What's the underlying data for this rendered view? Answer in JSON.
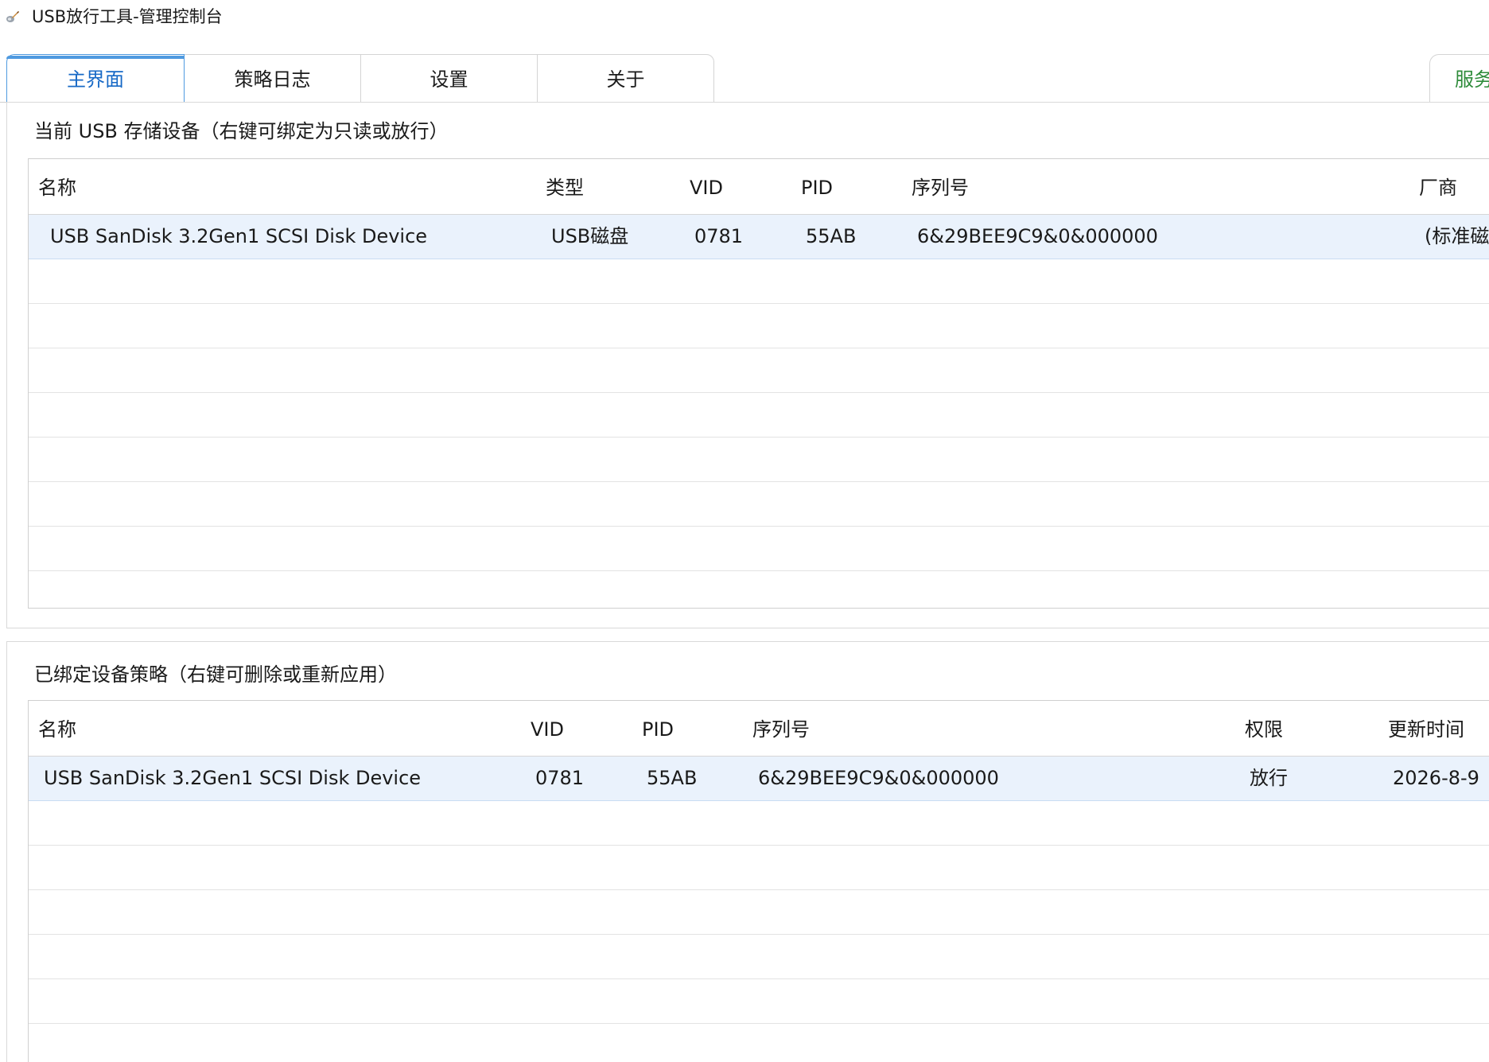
{
  "window": {
    "title": "USB放行工具-管理控制台",
    "icon": "app-brush-icon"
  },
  "tabs": [
    {
      "label": "主界面",
      "active": true
    },
    {
      "label": "策略日志",
      "active": false
    },
    {
      "label": "设置",
      "active": false
    },
    {
      "label": "关于",
      "active": false
    }
  ],
  "service_tab": {
    "label": "服务"
  },
  "devices_panel": {
    "title": "当前 USB 存储设备（右键可绑定为只读或放行）",
    "columns": [
      "名称",
      "类型",
      "VID",
      "PID",
      "序列号",
      "厂商"
    ],
    "rows": [
      {
        "name": "USB  SanDisk 3.2Gen1 SCSI Disk Device",
        "type": "USB磁盘",
        "vid": "0781",
        "pid": "55AB",
        "serial": "6&29BEE9C9&0&000000",
        "vendor": "(标准磁"
      }
    ]
  },
  "policies_panel": {
    "title": "已绑定设备策略（右键可删除或重新应用）",
    "columns": [
      "名称",
      "VID",
      "PID",
      "序列号",
      "权限",
      "更新时间"
    ],
    "rows": [
      {
        "name": "USB  SanDisk 3.2Gen1 SCSI Disk Device",
        "vid": "0781",
        "pid": "55AB",
        "serial": "6&29BEE9C9&0&000000",
        "permission": "放行",
        "updated": "2026-8-9"
      }
    ]
  },
  "colors": {
    "active_tab_text": "#1769c6",
    "active_tab_border": "#4f9ae0",
    "service_tab_text": "#2e8b3a",
    "selected_row_bg": "#eaf2fc"
  }
}
